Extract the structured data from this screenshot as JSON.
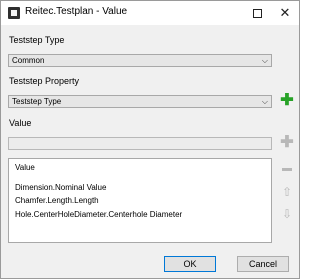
{
  "window": {
    "title": "Reitec.Testplan - Value",
    "close_glyph": "✕"
  },
  "teststep_type": {
    "label": "Teststep Type",
    "selected": "Common"
  },
  "teststep_property": {
    "label": "Teststep Property",
    "selected": "Teststep Type"
  },
  "value_section": {
    "label": "Value",
    "input_value": ""
  },
  "list": {
    "header": "Value",
    "items": [
      "Dimension.Nominal Value",
      "Chamfer.Length.Length",
      "Hole.CenterHoleDiameter.Centerhole Diameter"
    ]
  },
  "buttons": {
    "ok": "OK",
    "cancel": "Cancel"
  },
  "icons": {
    "dropdown_glyph": "⌵",
    "add_glyph": "✚",
    "up_glyph": "⇧",
    "down_glyph": "⇩"
  },
  "colors": {
    "add_enabled": "#27a227",
    "disabled_icon": "#b8b8b8",
    "focus_border": "#0078d7"
  }
}
